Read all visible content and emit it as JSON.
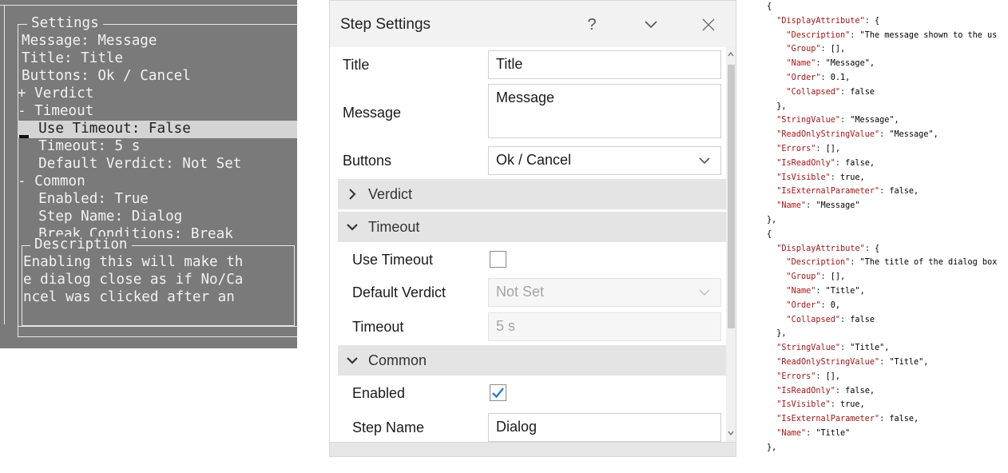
{
  "terminal": {
    "settings_title": "Settings",
    "description_title": "Description",
    "lines": [
      "Message: Message",
      "Title: Title",
      "Buttons: Ok / Cancel",
      "+ Verdict",
      "- Timeout",
      "  Use Timeout: False",
      "  Timeout: 5 s",
      "  Default Verdict: Not Set",
      "- Common",
      "  Enabled: True",
      "  Step Name: Dialog",
      "  Break Conditions: Break"
    ],
    "selected_line": "  Use Timeout: False",
    "description_lines": [
      "Enabling this will make th",
      "e dialog close as if No/Ca",
      "ncel was clicked after an"
    ]
  },
  "panel": {
    "title": "Step Settings",
    "help_label": "?",
    "title_row": {
      "label": "Title",
      "value": "Title"
    },
    "message_row": {
      "label": "Message",
      "value": "Message"
    },
    "buttons_row": {
      "label": "Buttons",
      "value": "Ok / Cancel"
    },
    "sections": {
      "verdict": "Verdict",
      "timeout": "Timeout",
      "common": "Common"
    },
    "use_timeout": {
      "label": "Use Timeout",
      "checked": false
    },
    "default_verdict": {
      "label": "Default Verdict",
      "value": "Not Set"
    },
    "timeout_row": {
      "label": "Timeout",
      "value": "5 s"
    },
    "enabled": {
      "label": "Enabled",
      "checked": true
    },
    "step_name": {
      "label": "Step Name",
      "value": "Dialog"
    },
    "accent_color": "#2d7bd2"
  },
  "json_lines": [
    "{",
    "  \"DisplayAttribute\": {",
    "    \"Description\": \"The message shown to the us",
    "    \"Group\": [],",
    "    \"Name\": \"Message\",",
    "    \"Order\": 0.1,",
    "    \"Collapsed\": false",
    "  },",
    "  \"StringValue\": \"Message\",",
    "  \"ReadOnlyStringValue\": \"Message\",",
    "  \"Errors\": [],",
    "  \"IsReadOnly\": false,",
    "  \"IsVisible\": true,",
    "  \"IsExternalParameter\": false,",
    "  \"Name\": \"Message\"",
    "},",
    "{",
    "  \"DisplayAttribute\": {",
    "    \"Description\": \"The title of the dialog box",
    "    \"Group\": [],",
    "    \"Name\": \"Title\",",
    "    \"Order\": 0,",
    "    \"Collapsed\": false",
    "  },",
    "  \"StringValue\": \"Title\",",
    "  \"ReadOnlyStringValue\": \"Title\",",
    "  \"Errors\": [],",
    "  \"IsReadOnly\": false,",
    "  \"IsVisible\": true,",
    "  \"IsExternalParameter\": false,",
    "  \"Name\": \"Title\"",
    "},"
  ]
}
